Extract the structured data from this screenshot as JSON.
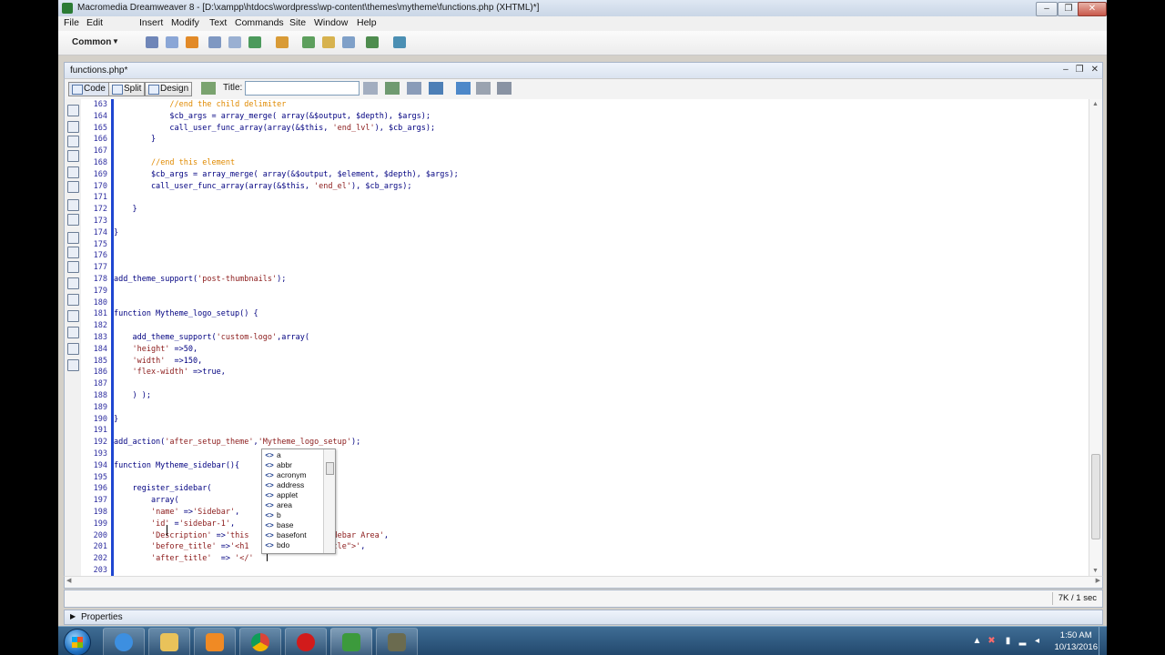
{
  "window": {
    "title": "Macromedia Dreamweaver 8 - [D:\\xampp\\htdocs\\wordpress\\wp-content\\themes\\mytheme\\functions.php (XHTML)*]",
    "controls": [
      "–",
      "❐",
      "✕"
    ]
  },
  "menu": [
    "File",
    "Edit",
    "Insert",
    "Modify",
    "Text",
    "Commands",
    "Site",
    "Window",
    "Help"
  ],
  "insert_bar": {
    "category": "Common",
    "icons": [
      "hyperlink-icon",
      "email-link-icon",
      "named-anchor-icon",
      "table-icon",
      "layer-icon",
      "images-icon",
      "media-icon",
      "date-icon",
      "comment-icon",
      "head-icon",
      "script-icon",
      "templates-icon",
      "tag-chooser-icon"
    ]
  },
  "document": {
    "tab": "functions.php*",
    "view_buttons": [
      "Code",
      "Split",
      "Design"
    ],
    "title_label": "Title:",
    "title_value": ""
  },
  "code": {
    "lines": [
      {
        "n": "163",
        "parts": [
          {
            "t": "            ",
            "c": ""
          },
          {
            "t": "//end the child delimiter",
            "c": "cmt"
          }
        ]
      },
      {
        "n": "164",
        "parts": [
          {
            "t": "            $cb_args = array_merge( array(&$output, $depth), $args);",
            "c": ""
          }
        ]
      },
      {
        "n": "165",
        "parts": [
          {
            "t": "            call_user_func_array(array(&$this, ",
            "c": ""
          },
          {
            "t": "'end_lvl'",
            "c": "str"
          },
          {
            "t": "), $cb_args);",
            "c": ""
          }
        ]
      },
      {
        "n": "166",
        "parts": [
          {
            "t": "        }",
            "c": ""
          }
        ]
      },
      {
        "n": "167",
        "parts": [
          {
            "t": "",
            "c": ""
          }
        ]
      },
      {
        "n": "168",
        "parts": [
          {
            "t": "        ",
            "c": ""
          },
          {
            "t": "//end this element",
            "c": "cmt"
          }
        ]
      },
      {
        "n": "169",
        "parts": [
          {
            "t": "        $cb_args = array_merge( array(&$output, $element, $depth), $args);",
            "c": ""
          }
        ]
      },
      {
        "n": "170",
        "parts": [
          {
            "t": "        call_user_func_array(array(&$this, ",
            "c": ""
          },
          {
            "t": "'end_el'",
            "c": "str"
          },
          {
            "t": "), $cb_args);",
            "c": ""
          }
        ]
      },
      {
        "n": "171",
        "parts": [
          {
            "t": "",
            "c": ""
          }
        ]
      },
      {
        "n": "172",
        "parts": [
          {
            "t": "    }",
            "c": ""
          }
        ]
      },
      {
        "n": "173",
        "parts": [
          {
            "t": "",
            "c": ""
          }
        ]
      },
      {
        "n": "174",
        "parts": [
          {
            "t": "}",
            "c": ""
          }
        ]
      },
      {
        "n": "175",
        "parts": [
          {
            "t": "",
            "c": ""
          }
        ]
      },
      {
        "n": "176",
        "parts": [
          {
            "t": "",
            "c": ""
          }
        ]
      },
      {
        "n": "177",
        "parts": [
          {
            "t": "",
            "c": ""
          }
        ]
      },
      {
        "n": "178",
        "parts": [
          {
            "t": "add_theme_support(",
            "c": ""
          },
          {
            "t": "'post-thumbnails'",
            "c": "str"
          },
          {
            "t": ");",
            "c": ""
          }
        ]
      },
      {
        "n": "179",
        "parts": [
          {
            "t": "",
            "c": ""
          }
        ]
      },
      {
        "n": "180",
        "parts": [
          {
            "t": "",
            "c": ""
          }
        ]
      },
      {
        "n": "181",
        "parts": [
          {
            "t": "function Mytheme_logo_setup() {",
            "c": ""
          }
        ]
      },
      {
        "n": "182",
        "parts": [
          {
            "t": "",
            "c": ""
          }
        ]
      },
      {
        "n": "183",
        "parts": [
          {
            "t": "    add_theme_support(",
            "c": ""
          },
          {
            "t": "'custom-logo'",
            "c": "str"
          },
          {
            "t": ",array(",
            "c": ""
          }
        ]
      },
      {
        "n": "184",
        "parts": [
          {
            "t": "    ",
            "c": ""
          },
          {
            "t": "'height'",
            "c": "str"
          },
          {
            "t": " =>50,",
            "c": ""
          }
        ]
      },
      {
        "n": "185",
        "parts": [
          {
            "t": "    ",
            "c": ""
          },
          {
            "t": "'width'",
            "c": "str"
          },
          {
            "t": "  =>150,",
            "c": ""
          }
        ]
      },
      {
        "n": "186",
        "parts": [
          {
            "t": "    ",
            "c": ""
          },
          {
            "t": "'flex-width'",
            "c": "str"
          },
          {
            "t": " =>true,",
            "c": ""
          }
        ]
      },
      {
        "n": "187",
        "parts": [
          {
            "t": "",
            "c": ""
          }
        ]
      },
      {
        "n": "188",
        "parts": [
          {
            "t": "    ) );",
            "c": ""
          }
        ]
      },
      {
        "n": "189",
        "parts": [
          {
            "t": "",
            "c": ""
          }
        ]
      },
      {
        "n": "190",
        "parts": [
          {
            "t": "}",
            "c": ""
          }
        ]
      },
      {
        "n": "191",
        "parts": [
          {
            "t": "",
            "c": ""
          }
        ]
      },
      {
        "n": "192",
        "parts": [
          {
            "t": "add_action(",
            "c": ""
          },
          {
            "t": "'after_setup_theme'",
            "c": "str"
          },
          {
            "t": ",",
            "c": ""
          },
          {
            "t": "'Mytheme_logo_setup'",
            "c": "str"
          },
          {
            "t": ");",
            "c": ""
          }
        ]
      },
      {
        "n": "193",
        "parts": [
          {
            "t": "",
            "c": ""
          }
        ]
      },
      {
        "n": "194",
        "parts": [
          {
            "t": "function Mytheme_sidebar(){",
            "c": ""
          }
        ]
      },
      {
        "n": "195",
        "parts": [
          {
            "t": "",
            "c": ""
          }
        ]
      },
      {
        "n": "196",
        "parts": [
          {
            "t": "    register_sidebar(",
            "c": ""
          }
        ]
      },
      {
        "n": "197",
        "parts": [
          {
            "t": "        array(",
            "c": ""
          }
        ]
      },
      {
        "n": "198",
        "parts": [
          {
            "t": "        ",
            "c": ""
          },
          {
            "t": "'name'",
            "c": "str"
          },
          {
            "t": " =>",
            "c": ""
          },
          {
            "t": "'Sidebar'",
            "c": "str"
          },
          {
            "t": ",",
            "c": ""
          }
        ]
      },
      {
        "n": "199",
        "parts": [
          {
            "t": "        ",
            "c": ""
          },
          {
            "t": "'id'",
            "c": "str"
          },
          {
            "t": " =",
            "c": ""
          },
          {
            "t": "'sidebar-1'",
            "c": "str"
          },
          {
            "t": ",",
            "c": ""
          }
        ]
      },
      {
        "n": "200",
        "parts": [
          {
            "t": "        ",
            "c": ""
          },
          {
            "t": "'Description'",
            "c": "str"
          },
          {
            "t": " =>",
            "c": ""
          },
          {
            "t": "'this                 idebar Area'",
            "c": "str"
          },
          {
            "t": ",",
            "c": ""
          }
        ]
      },
      {
        "n": "201",
        "parts": [
          {
            "t": "        ",
            "c": ""
          },
          {
            "t": "'before_title'",
            "c": "str"
          },
          {
            "t": " =>",
            "c": ""
          },
          {
            "t": "'<h1               -title\">'",
            "c": "str"
          },
          {
            "t": ",",
            "c": ""
          }
        ]
      },
      {
        "n": "202",
        "parts": [
          {
            "t": "        ",
            "c": ""
          },
          {
            "t": "'after_title'",
            "c": "str"
          },
          {
            "t": "  => ",
            "c": ""
          },
          {
            "t": "'</'",
            "c": "str"
          }
        ]
      },
      {
        "n": "203",
        "parts": [
          {
            "t": "",
            "c": ""
          }
        ]
      }
    ]
  },
  "code_hints": {
    "items": [
      "a",
      "abbr",
      "acronym",
      "address",
      "applet",
      "area",
      "b",
      "base",
      "basefont",
      "bdo"
    ]
  },
  "status": {
    "size_time": "7K / 1 sec"
  },
  "properties_panel": {
    "label": "Properties"
  },
  "taskbar": {
    "apps": [
      "ie-icon",
      "explorer-icon",
      "media-player-icon",
      "chrome-icon",
      "opera-icon",
      "dreamweaver-icon",
      "app-icon"
    ],
    "time": "1:50 AM",
    "date": "10/13/2016"
  },
  "colors": {
    "code_text": "#000080",
    "string": "#8b1a1a",
    "comment": "#e08a00",
    "gutter_border": "#1e46d1"
  }
}
